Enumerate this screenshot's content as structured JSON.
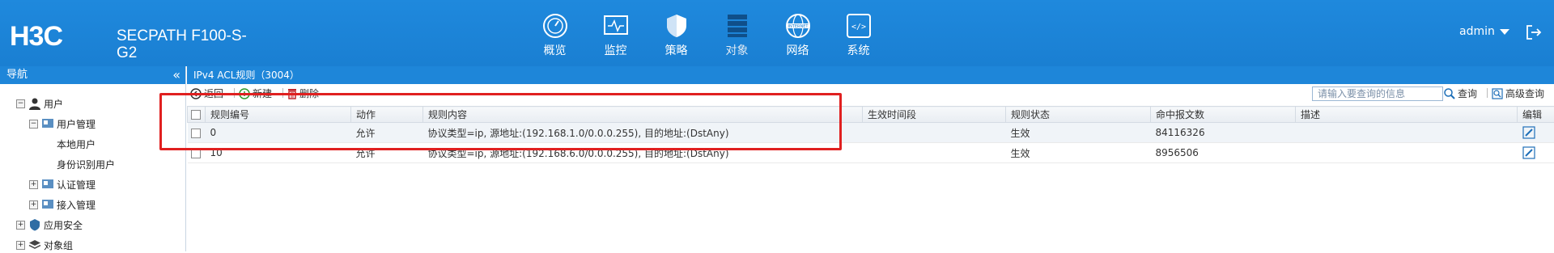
{
  "header": {
    "product_name_line1": "SECPATH F100-S-",
    "product_name_line2": "G2",
    "nav": [
      {
        "label": "概览",
        "icon": "dashboard-icon"
      },
      {
        "label": "监控",
        "icon": "monitor-icon"
      },
      {
        "label": "策略",
        "icon": "shield-icon"
      },
      {
        "label": "对象",
        "icon": "objects-icon",
        "active": true
      },
      {
        "label": "网络",
        "icon": "internet-globe-icon"
      },
      {
        "label": "系统",
        "icon": "code-icon"
      }
    ],
    "user": "admin"
  },
  "sidebar": {
    "title": "导航",
    "collapse": "«",
    "items": [
      {
        "label": "用户",
        "expander": "−"
      },
      {
        "label": "用户管理",
        "expander": "−"
      },
      {
        "label": "本地用户"
      },
      {
        "label": "身份识别用户"
      },
      {
        "label": "认证管理",
        "expander": "+"
      },
      {
        "label": "接入管理",
        "expander": "+"
      },
      {
        "label": "应用安全",
        "expander": "+"
      },
      {
        "label": "对象组",
        "expander": "+"
      }
    ]
  },
  "content": {
    "title": "IPv4 ACL规则（3004）",
    "toolbar": {
      "back": "返回",
      "new": "新建",
      "delete": "删除",
      "search_placeholder": "请输入要查询的信息",
      "query": "查询",
      "advanced_query": "高级查询"
    },
    "table": {
      "columns": [
        "规则编号",
        "动作",
        "规则内容",
        "生效时间段",
        "规则状态",
        "命中报文数",
        "描述",
        "编辑"
      ],
      "rows": [
        {
          "id": "0",
          "action": "允许",
          "content": "协议类型=ip, 源地址:(192.168.1.0/0.0.0.255), 目的地址:(DstAny)",
          "time": "",
          "status": "生效",
          "hits": "84116326",
          "desc": ""
        },
        {
          "id": "10",
          "action": "允许",
          "content": "协议类型=ip, 源地址:(192.168.6.0/0.0.0.255), 目的地址:(DstAny)",
          "time": "",
          "status": "生效",
          "hits": "8956506",
          "desc": ""
        }
      ]
    }
  },
  "colors": {
    "header_blue": "#1a7fd2",
    "highlight_red": "#e02020"
  }
}
